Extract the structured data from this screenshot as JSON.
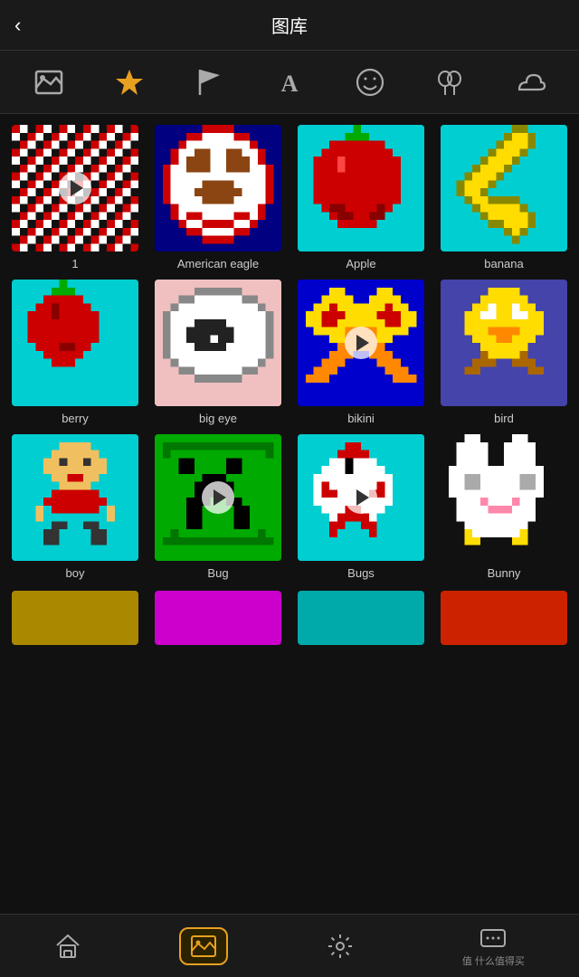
{
  "header": {
    "title": "图库",
    "back_label": "‹"
  },
  "tabs": [
    {
      "id": "all",
      "label": "all",
      "icon": "image"
    },
    {
      "id": "favorites",
      "label": "favorites",
      "icon": "star",
      "active": true
    },
    {
      "id": "flag",
      "label": "flag",
      "icon": "flag"
    },
    {
      "id": "text",
      "label": "text",
      "icon": "A"
    },
    {
      "id": "emoji",
      "label": "emoji",
      "icon": "emoji"
    },
    {
      "id": "balloon",
      "label": "balloon",
      "icon": "balloon"
    },
    {
      "id": "cloud",
      "label": "cloud",
      "icon": "cloud"
    }
  ],
  "grid_items": [
    {
      "id": "item-1",
      "label": "1",
      "has_play": true,
      "bg": "#111",
      "type": "pixel_1"
    },
    {
      "id": "item-american-eagle",
      "label": "American eagle",
      "has_play": false,
      "bg": "#000080",
      "type": "pixel_eagle"
    },
    {
      "id": "item-apple",
      "label": "Apple",
      "has_play": false,
      "bg": "#00ced1",
      "type": "pixel_apple"
    },
    {
      "id": "item-banana",
      "label": "banana",
      "has_play": false,
      "bg": "#00ced1",
      "type": "pixel_banana"
    },
    {
      "id": "item-berry",
      "label": "berry",
      "has_play": false,
      "bg": "#00ced1",
      "type": "pixel_berry"
    },
    {
      "id": "item-big-eye",
      "label": "big eye",
      "has_play": false,
      "bg": "#f0c0c0",
      "type": "pixel_bigeye"
    },
    {
      "id": "item-bikini",
      "label": "bikini",
      "has_play": true,
      "bg": "#0000cd",
      "type": "pixel_bikini"
    },
    {
      "id": "item-bird",
      "label": "bird",
      "has_play": false,
      "bg": "#4444aa",
      "type": "pixel_bird"
    },
    {
      "id": "item-boy",
      "label": "boy",
      "has_play": false,
      "bg": "#00ced1",
      "type": "pixel_boy"
    },
    {
      "id": "item-bug",
      "label": "Bug",
      "has_play": true,
      "bg": "#00aa00",
      "type": "pixel_bug"
    },
    {
      "id": "item-bugs",
      "label": "Bugs",
      "has_play": true,
      "bg": "#00ced1",
      "type": "pixel_bugs"
    },
    {
      "id": "item-bunny",
      "label": "Bunny",
      "has_play": false,
      "bg": "#111",
      "type": "pixel_bunny"
    }
  ],
  "partial_items": [
    {
      "id": "partial-1",
      "bg": "#aa8800"
    },
    {
      "id": "partial-2",
      "bg": "#cc00cc"
    },
    {
      "id": "partial-3",
      "bg": "#00aaaa"
    },
    {
      "id": "partial-4",
      "bg": "#cc2200"
    }
  ],
  "bottom_nav": [
    {
      "id": "home",
      "label": "",
      "icon": "home"
    },
    {
      "id": "gallery",
      "label": "",
      "icon": "gallery",
      "active": true
    },
    {
      "id": "settings",
      "label": "",
      "icon": "settings"
    },
    {
      "id": "more",
      "label": "值 什么值得买",
      "icon": "more"
    }
  ]
}
